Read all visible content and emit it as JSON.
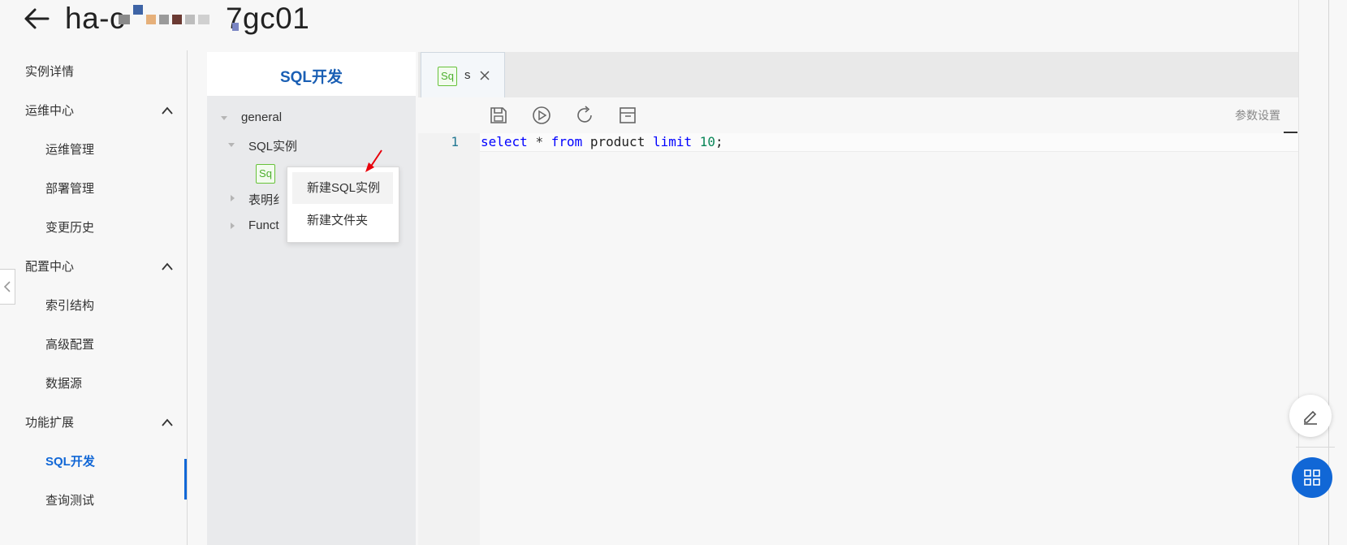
{
  "header": {
    "title_start": "ha-c",
    "title_end": "7gc01"
  },
  "nav": {
    "instance_detail": "实例详情",
    "ops_center": "运维中心",
    "ops_manage": "运维管理",
    "deploy_manage": "部署管理",
    "change_history": "变更历史",
    "config_center": "配置中心",
    "index_structure": "索引结构",
    "advanced_config": "高级配置",
    "data_source": "数据源",
    "ext": "功能扩展",
    "sql_dev": "SQL开发",
    "query_test": "查询测试"
  },
  "tree": {
    "title": "SQL开发",
    "general": "general",
    "sql_instances": "SQL实例",
    "sq_badge": "Sq",
    "table_partial": "表明纟",
    "func_partial": "Funct"
  },
  "context_menu": {
    "new_sql": "新建SQL实例",
    "new_folder": "新建文件夹"
  },
  "editor": {
    "tab_badge": "Sq",
    "tab_label": "s",
    "params_label": "参数设置",
    "line_number": "1",
    "code": {
      "kw_select": "select",
      "star": "*",
      "kw_from": "from",
      "table": "product",
      "kw_limit": "limit",
      "num": "10",
      "end": ";"
    }
  },
  "colors": {
    "accent": "#1167d6",
    "badge_green": "#67c23a",
    "arrow_red": "#e8000b"
  }
}
